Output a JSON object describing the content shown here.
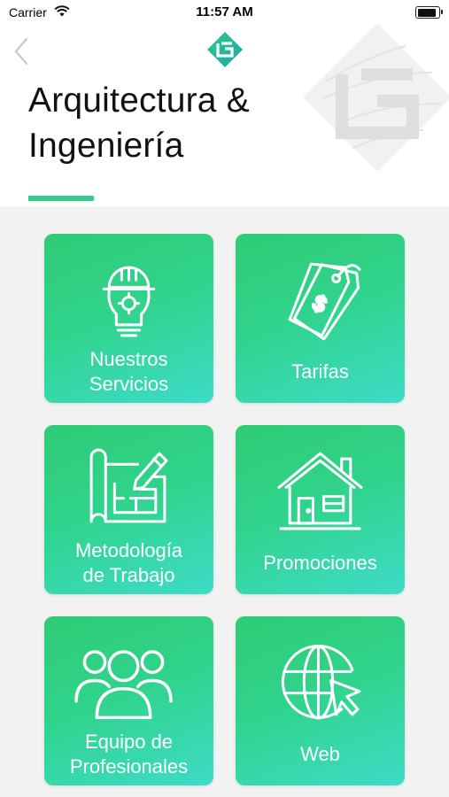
{
  "status_bar": {
    "carrier": "Carrier",
    "time": "11:57 AM"
  },
  "header": {
    "title_line1": "Arquitectura &",
    "title_line2": "Ingeniería"
  },
  "tiles": [
    {
      "label_line1": "Nuestros",
      "label_line2": "Servicios",
      "icon": "lightbulb-helmet-icon"
    },
    {
      "label": "Tarifas",
      "icon": "price-tag-icon"
    },
    {
      "label_line1": "Metodología",
      "label_line2": "de Trabajo",
      "icon": "blueprint-icon"
    },
    {
      "label": "Promociones",
      "icon": "house-icon"
    },
    {
      "label_line1": "Equipo de",
      "label_line2": "Profesionales",
      "icon": "team-icon"
    },
    {
      "label": "Web",
      "icon": "globe-cursor-icon"
    }
  ],
  "colors": {
    "accent": "#2fcf8a",
    "tile_start": "#2fcc76",
    "tile_end": "#3ddcc8"
  }
}
